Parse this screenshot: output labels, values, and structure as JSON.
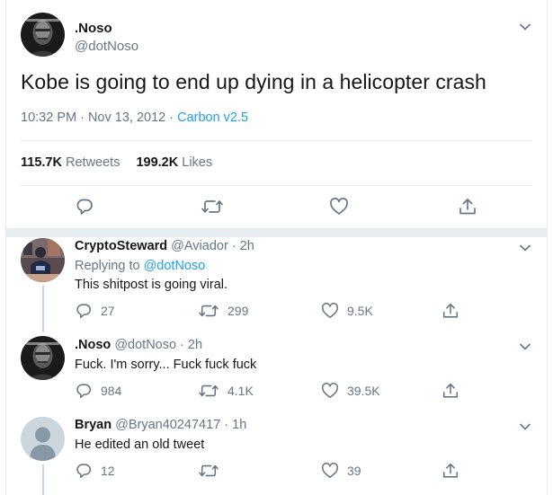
{
  "main_tweet": {
    "name": ".Noso",
    "handle": "@dotNoso",
    "text": "Kobe is going to end up dying in a helicopter crash",
    "time": "10:32 PM · Nov 13, 2012 · ",
    "source": "Carbon v2.5",
    "retweets_count": "115.7K",
    "retweets_label": "Retweets",
    "likes_count": "199.2K",
    "likes_label": "Likes"
  },
  "replies": [
    {
      "name": "CryptoSteward",
      "handle": "@Aviador · 2h",
      "replying_label": "Replying to ",
      "replying_to": "@dotNoso",
      "text": "This shitpost is going viral.",
      "reply_count": "27",
      "retweet_count": "299",
      "like_count": "9.5K"
    },
    {
      "name": ".Noso",
      "handle": "@dotNoso · 2h",
      "text": "Fuck. I'm sorry... Fuck fuck fuck",
      "reply_count": "984",
      "retweet_count": "4.1K",
      "like_count": "39.5K"
    },
    {
      "name": "Bryan",
      "handle": "@Bryan40247417 · 1h",
      "text": "He edited an old tweet",
      "reply_count": "12",
      "retweet_count": "",
      "like_count": "39"
    }
  ],
  "colors": {
    "accent": "#1da1f2",
    "secondary_text": "#657786",
    "border": "#e6ecf0"
  },
  "icons": [
    "chevron-down-icon",
    "reply-icon",
    "retweet-icon",
    "like-icon",
    "share-icon",
    "default-avatar-icon"
  ]
}
